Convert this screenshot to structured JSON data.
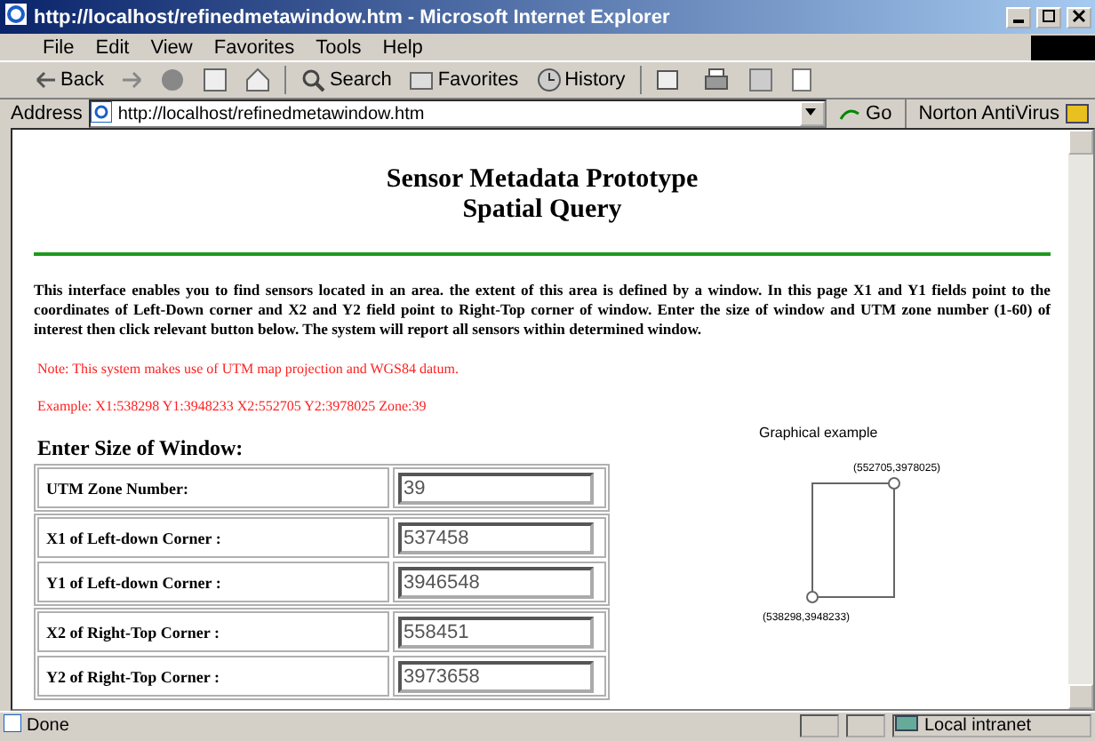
{
  "window": {
    "title": "http://localhost/refinedmetawindow.htm - Microsoft Internet Explorer"
  },
  "menu": [
    "File",
    "Edit",
    "View",
    "Favorites",
    "Tools",
    "Help"
  ],
  "toolbar": {
    "back": "Back",
    "search": "Search",
    "favorites": "Favorites",
    "history": "History"
  },
  "address": {
    "label": "Address",
    "url": "http://localhost/refinedmetawindow.htm",
    "go": "Go",
    "addon": "Norton AntiVirus"
  },
  "page": {
    "heading": [
      "Sensor Metadata Prototype",
      "Spatial Query"
    ],
    "intro": "This interface enables you to find sensors located in an area. the extent of this area is defined by a window. In this page X1 and Y1 fields point to the coordinates of Left-Down corner and X2 and Y2 field point to Right-Top corner of window. Enter the size of window and UTM zone number (1-60) of interest then click relevant button below. The system  will report all sensors within determined window.",
    "note": "Note: This system makes use of UTM map projection and WGS84 datum.",
    "example": "Example: X1:538298 Y1:3948233 X2:552705 Y2:3978025  Zone:39",
    "form_title": "Enter Size of Window:",
    "field_groups": [
      [
        {
          "label": "UTM Zone Number:",
          "value": "39"
        }
      ],
      [
        {
          "label": "X1 of Left-down Corner :",
          "value": "537458"
        },
        {
          "label": "Y1 of Left-down Corner :",
          "value": "3946548"
        }
      ],
      [
        {
          "label": "X2 of Right-Top Corner  :",
          "value": "558451"
        },
        {
          "label": "Y2 of Right-Top Corner  :",
          "value": "3973658"
        }
      ]
    ],
    "diagram": {
      "title": "Graphical example",
      "top_right": "(552705,3978025)",
      "bottom_left": "(538298,3948233)"
    }
  },
  "status_bar": {
    "text": "Done",
    "zone": "Local intranet"
  }
}
